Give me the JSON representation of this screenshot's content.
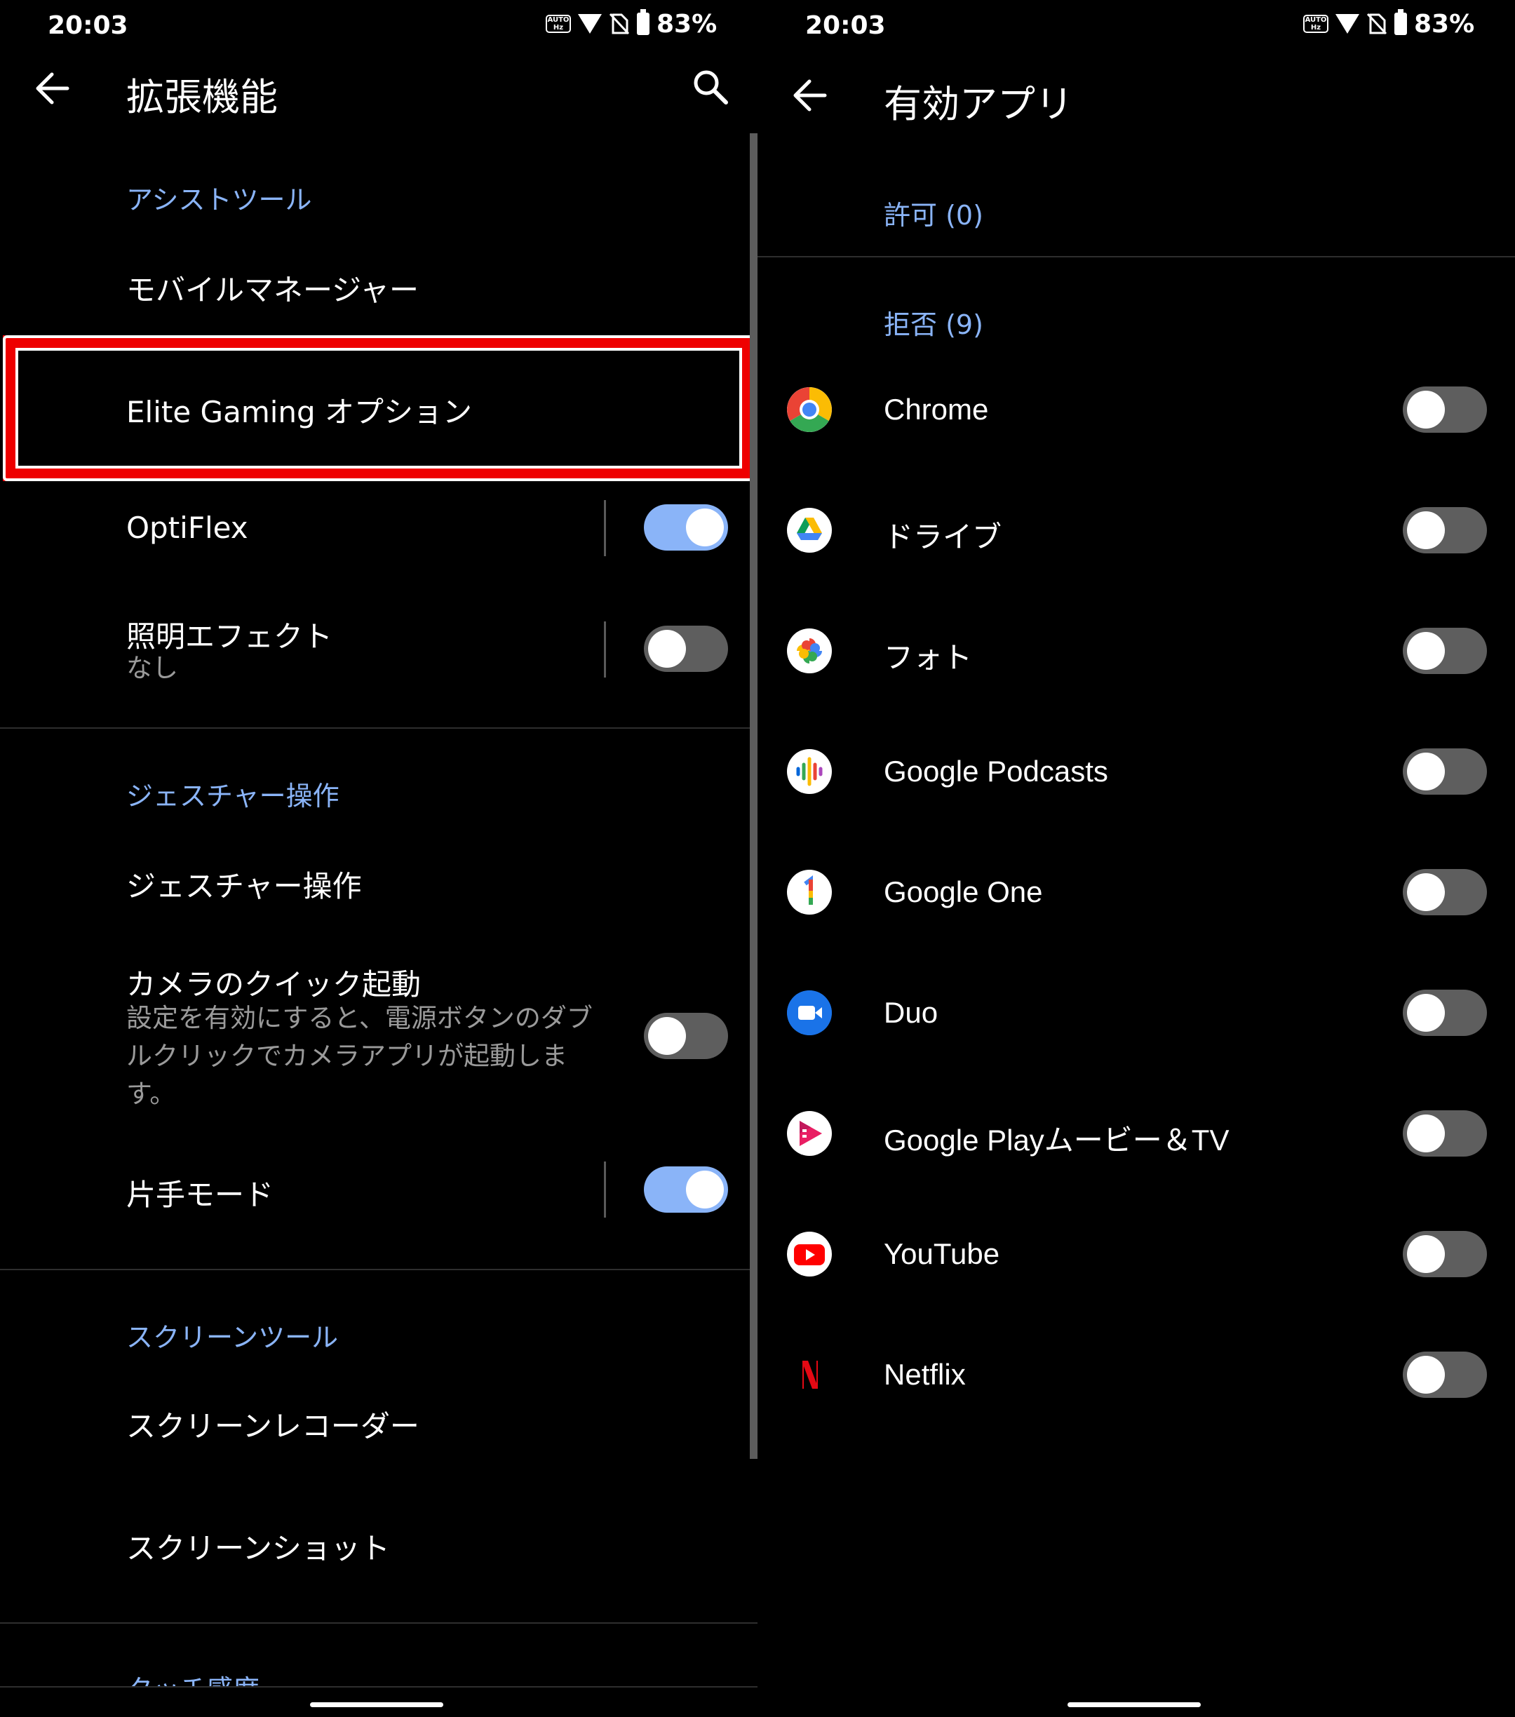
{
  "left": {
    "status": {
      "time": "20:03",
      "battery": "83%",
      "hz_badge": "AUTO Hz"
    },
    "header": {
      "title": "拡張機能"
    },
    "sections": {
      "assist_tools": "アシストツール",
      "gesture": "ジェスチャー操作",
      "screen_tools": "スクリーンツール",
      "touch": "タッチ感度"
    },
    "items": {
      "mobile_manager": "モバイルマネージャー",
      "elite_gaming": "Elite Gaming オプション",
      "optiflex": "OptiFlex",
      "lighting": "照明エフェクト",
      "lighting_sub": "なし",
      "gesture_ops": "ジェスチャー操作",
      "camera_quick": "カメラのクイック起動",
      "camera_sub_1": "設定を有効にすると、電源ボタンのダブ",
      "camera_sub_2": "ルクリックでカメラアプリが起動しま",
      "camera_sub_3": "す。",
      "one_hand": "片手モード",
      "screen_recorder": "スクリーンレコーダー",
      "screenshot": "スクリーンショット"
    },
    "toggles": {
      "optiflex": true,
      "lighting": false,
      "camera_quick": false,
      "one_hand": true
    }
  },
  "right": {
    "status": {
      "time": "20:03",
      "battery": "83%"
    },
    "header": {
      "title": "有効アプリ"
    },
    "allowed_label": "許可 (0)",
    "denied_label": "拒否 (9)",
    "apps": [
      {
        "name": "Chrome",
        "icon": "chrome-icon",
        "enabled": false
      },
      {
        "name": "ドライブ",
        "icon": "drive-icon",
        "enabled": false
      },
      {
        "name": "フォト",
        "icon": "photos-icon",
        "enabled": false
      },
      {
        "name": "Google Podcasts",
        "icon": "podcasts-icon",
        "enabled": false
      },
      {
        "name": "Google One",
        "icon": "google-one-icon",
        "enabled": false
      },
      {
        "name": "Duo",
        "icon": "duo-icon",
        "enabled": false
      },
      {
        "name": "Google Playムービー＆TV",
        "icon": "play-movies-icon",
        "enabled": false
      },
      {
        "name": "YouTube",
        "icon": "youtube-icon",
        "enabled": false
      },
      {
        "name": "Netflix",
        "icon": "netflix-icon",
        "enabled": false
      }
    ]
  },
  "colors": {
    "accent": "#8ab4f8",
    "highlight_border": "#ee0000",
    "toggle_off": "#5e5e5e",
    "background": "#000000"
  }
}
